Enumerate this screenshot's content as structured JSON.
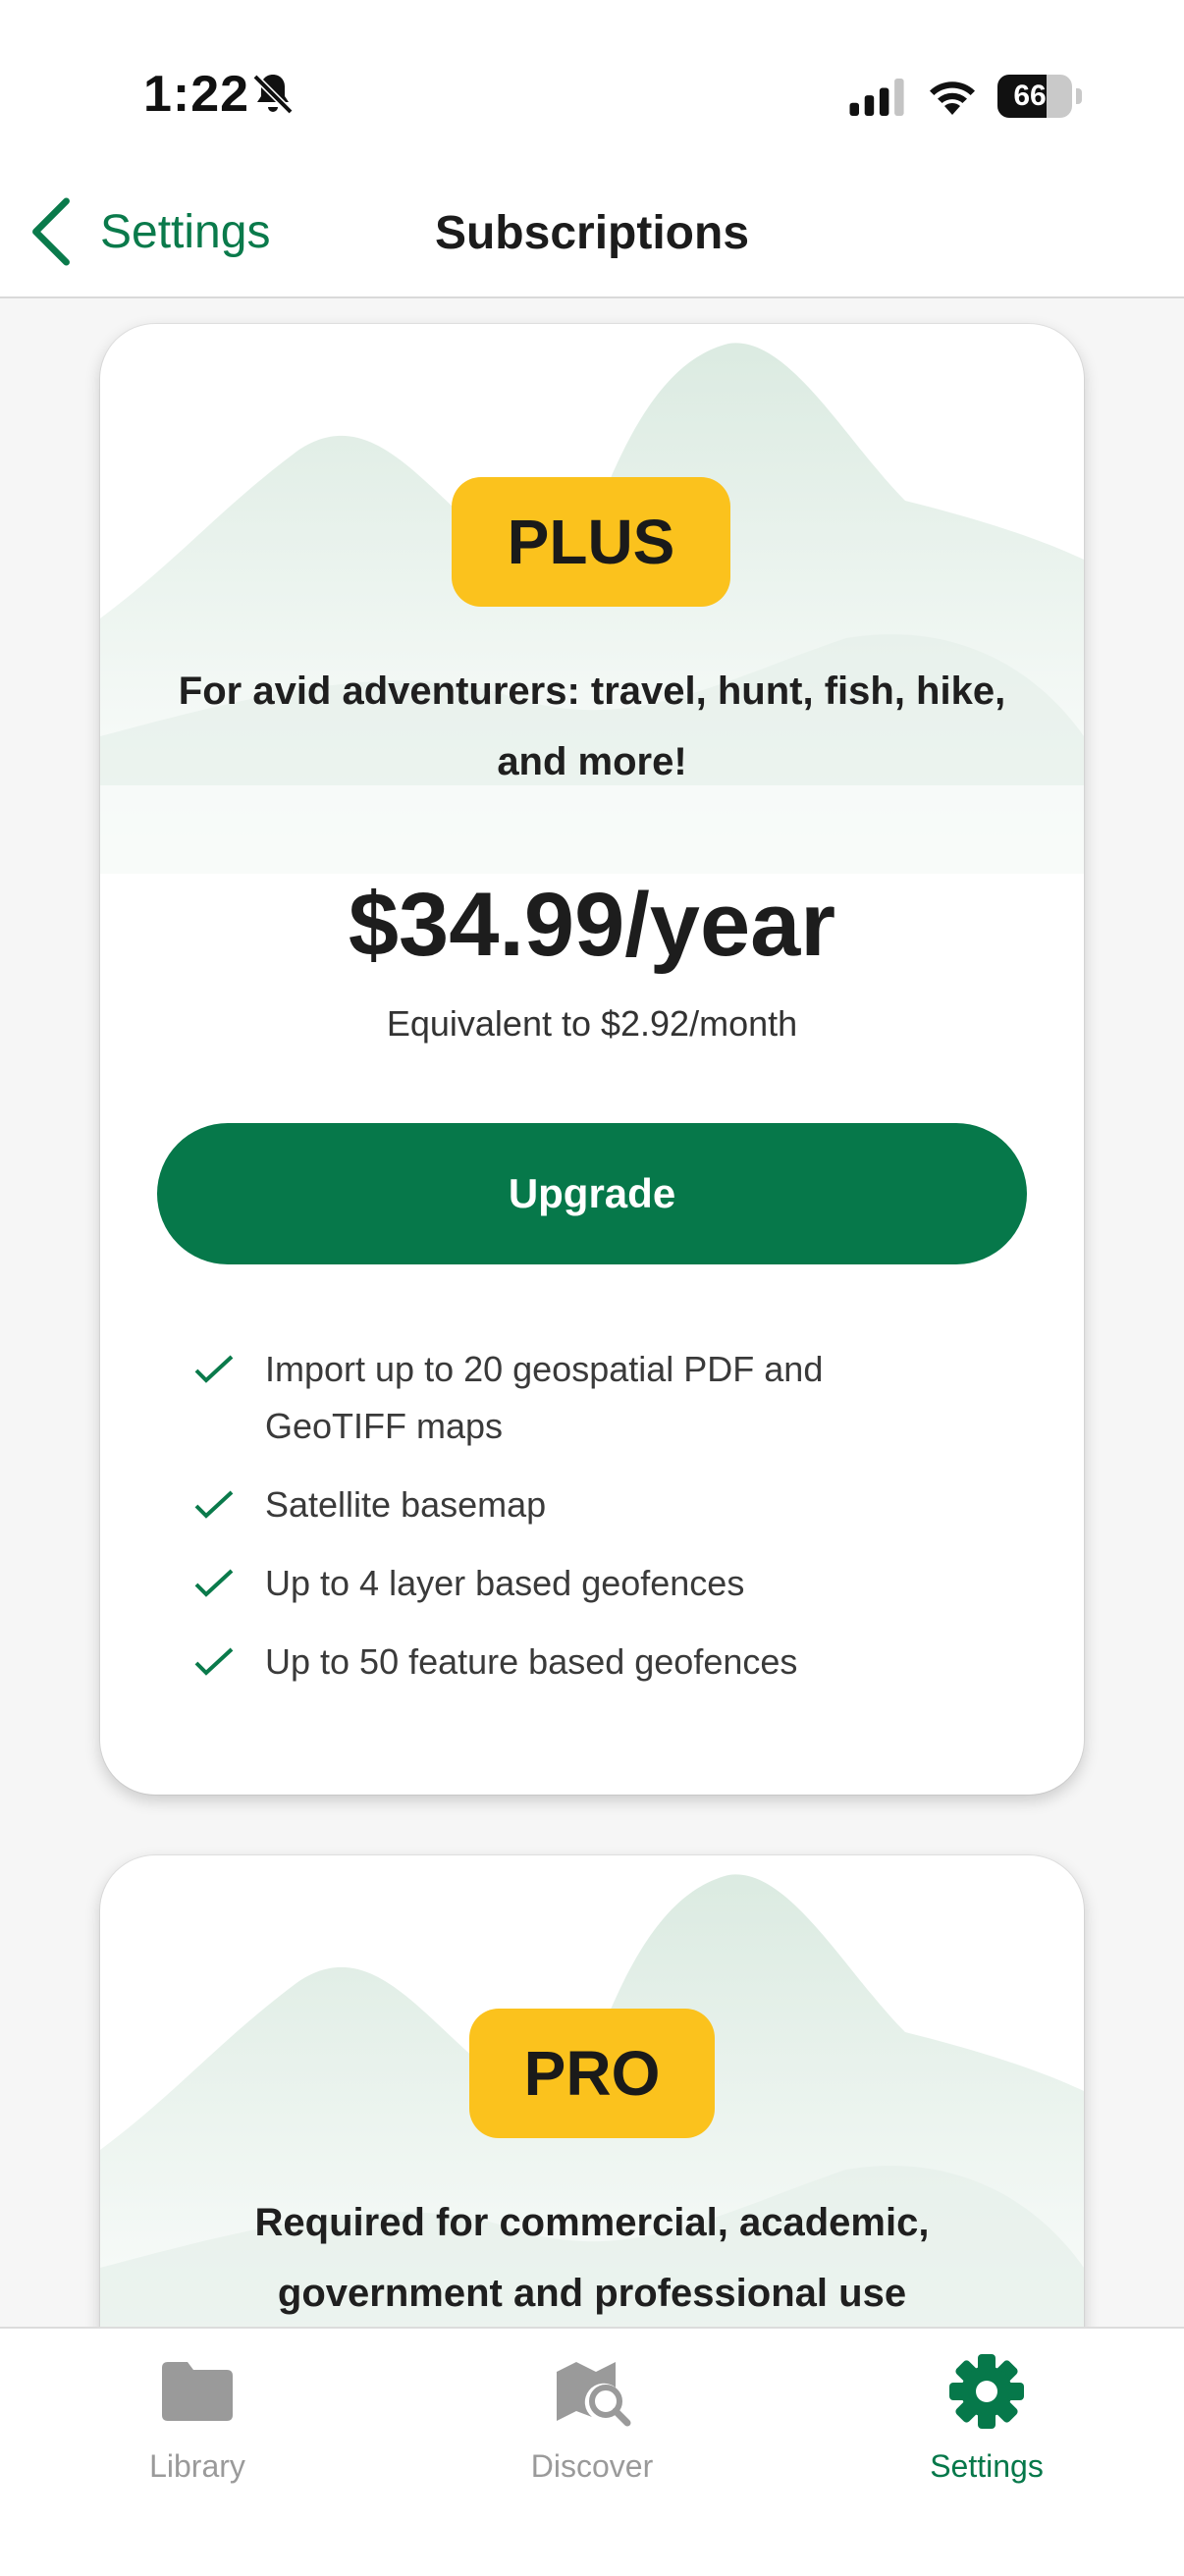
{
  "status_bar": {
    "time": "1:22",
    "battery": "66",
    "battery_level": 0.66,
    "icons": [
      "bell-slash-icon",
      "cellular-signal-icon",
      "wifi-icon",
      "battery-icon"
    ]
  },
  "nav": {
    "back_label": "Settings",
    "title": "Subscriptions"
  },
  "plans": [
    {
      "tier": "PLUS",
      "tagline_line1": "For avid adventurers: travel, hunt, fish, hike,",
      "tagline_line2": "and more!",
      "price": "$34.99/year",
      "equivalent": "Equivalent to $2.92/month",
      "button_label": "Upgrade",
      "features": [
        "Import up to 20 geospatial PDF and",
        "GeoTIFF maps",
        "Satellite basemap",
        "Up to 4 layer based geofences",
        "Up to 50 feature based geofences"
      ]
    },
    {
      "tier": "PRO",
      "tagline_line1": "Required for commercial, academic,",
      "tagline_line2": "government and professional use"
    }
  ],
  "tabs": [
    {
      "label": "Library",
      "icon": "folder-icon",
      "active": false
    },
    {
      "label": "Discover",
      "icon": "map-search-icon",
      "active": false
    },
    {
      "label": "Settings",
      "icon": "gear-icon",
      "active": true
    }
  ],
  "colors": {
    "accent": "#06784a",
    "badge": "#fbc21d",
    "inactive_tab": "#9a9a9a",
    "mountain": "#dde9e2"
  }
}
